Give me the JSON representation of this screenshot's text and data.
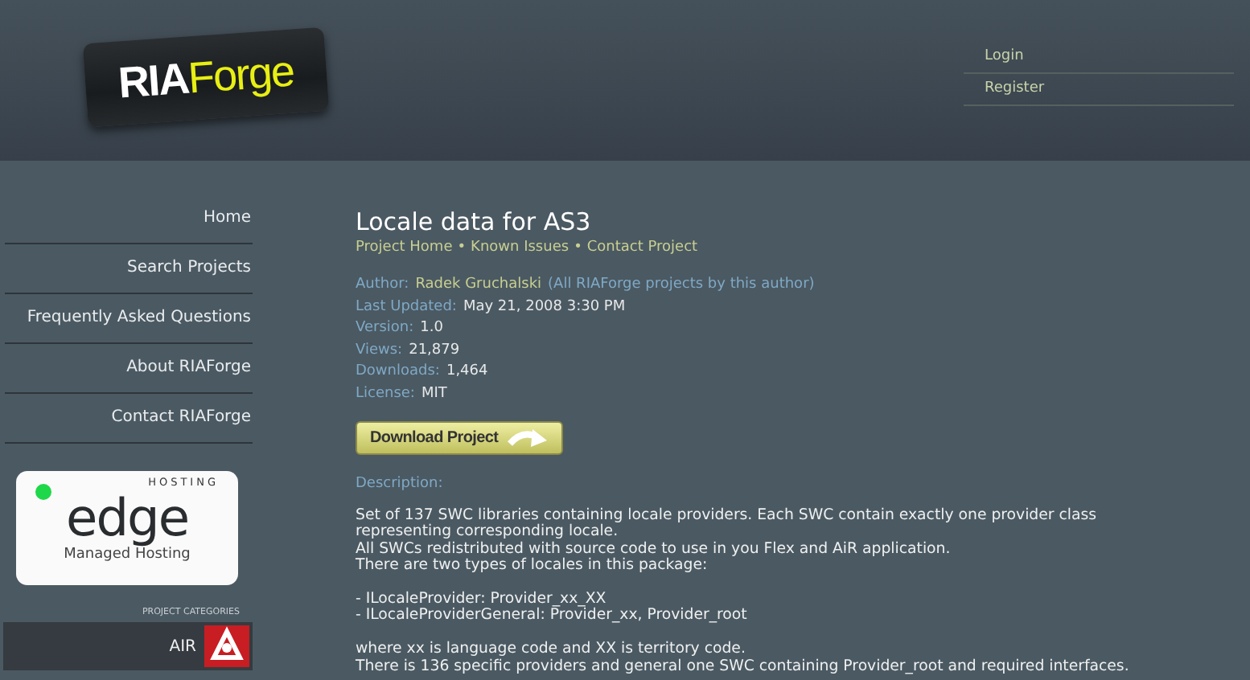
{
  "logo": {
    "part_1": "RIA",
    "part_2": "Forge"
  },
  "account_links": [
    "Login",
    "Register"
  ],
  "sidebar": {
    "items": [
      "Home",
      "Search Projects",
      "Frequently Asked Questions",
      "About RIAForge",
      "Contact RIAForge"
    ],
    "ad": {
      "top": "HOSTING",
      "brand": "edge",
      "tagline": "Managed Hosting"
    },
    "categories_heading": "PROJECT CATEGORIES",
    "categories": [
      "AIR"
    ]
  },
  "project": {
    "title": "Locale data for AS3",
    "links": [
      "Project Home",
      "Known Issues",
      "Contact Project"
    ],
    "separator": "•",
    "meta": [
      {
        "label": "Author:",
        "value": "Radek Gruchalski",
        "link": "(All RIAForge projects by this author)"
      },
      {
        "label": "Last Updated:",
        "value": "May 21, 2008 3:30 PM"
      },
      {
        "label": "Version:",
        "value": "1.0"
      },
      {
        "label": "Views:",
        "value": "21,879"
      },
      {
        "label": "Downloads:",
        "value": "1,464"
      },
      {
        "label": "License:",
        "value": "MIT"
      }
    ],
    "download_button": "Download Project",
    "description_label": "Description:",
    "description": [
      [
        "Set of 137 SWC libraries containing locale providers. Each SWC contain exactly one provider class representing corresponding locale.",
        "All SWCs redistributed with source code to use in you Flex and AiR application.",
        "There are two types of locales in this package:"
      ],
      [
        "- ILocaleProvider: Provider_xx_XX",
        "- ILocaleProviderGeneral: Provider_xx, Provider_root"
      ],
      [
        "where xx is language code and XX is territory code.",
        "There is 136 specific providers and general one SWC containing Provider_root and required interfaces."
      ]
    ]
  }
}
